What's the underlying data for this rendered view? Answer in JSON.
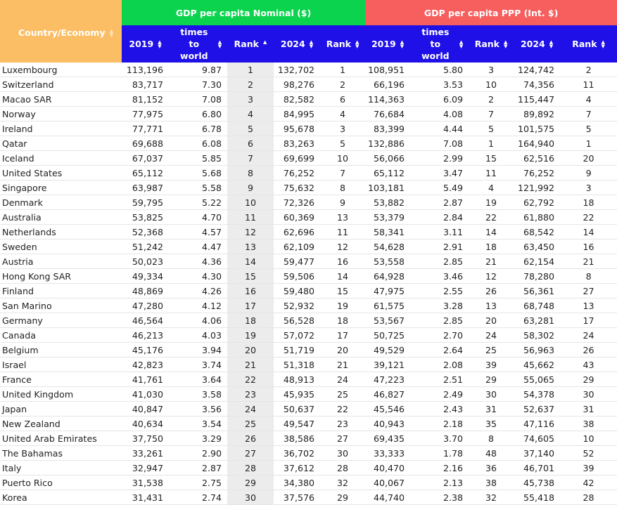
{
  "header": {
    "country": "Country/Economy",
    "nominal_group": "GDP per capita Nominal ($)",
    "ppp_group": "GDP per capita PPP (Int. $)",
    "columns": [
      "2019",
      "times to world",
      "Rank",
      "2024",
      "Rank",
      "2019",
      "times to world",
      "Rank",
      "2024",
      "Rank"
    ],
    "sorted_column": "Rank",
    "sort_direction": "ascending"
  },
  "colors": {
    "country_header": "#fbbe65",
    "nominal_header": "#0bd34d",
    "ppp_header": "#f75f5f",
    "sub_header": "#1e10e6"
  },
  "rows": [
    {
      "country": "Luxembourg",
      "n2019": "113,196",
      "ntimes": "9.87",
      "nrank": "1",
      "n2024": "132,702",
      "nrank24": "1",
      "p2019": "108,951",
      "ptimes": "5.80",
      "prank": "3",
      "p2024": "124,742",
      "prank24": "2"
    },
    {
      "country": "Switzerland",
      "n2019": "83,717",
      "ntimes": "7.30",
      "nrank": "2",
      "n2024": "98,276",
      "nrank24": "2",
      "p2019": "66,196",
      "ptimes": "3.53",
      "prank": "10",
      "p2024": "74,356",
      "prank24": "11"
    },
    {
      "country": "Macao SAR",
      "n2019": "81,152",
      "ntimes": "7.08",
      "nrank": "3",
      "n2024": "82,582",
      "nrank24": "6",
      "p2019": "114,363",
      "ptimes": "6.09",
      "prank": "2",
      "p2024": "115,447",
      "prank24": "4"
    },
    {
      "country": "Norway",
      "n2019": "77,975",
      "ntimes": "6.80",
      "nrank": "4",
      "n2024": "84,995",
      "nrank24": "4",
      "p2019": "76,684",
      "ptimes": "4.08",
      "prank": "7",
      "p2024": "89,892",
      "prank24": "7"
    },
    {
      "country": "Ireland",
      "n2019": "77,771",
      "ntimes": "6.78",
      "nrank": "5",
      "n2024": "95,678",
      "nrank24": "3",
      "p2019": "83,399",
      "ptimes": "4.44",
      "prank": "5",
      "p2024": "101,575",
      "prank24": "5"
    },
    {
      "country": "Qatar",
      "n2019": "69,688",
      "ntimes": "6.08",
      "nrank": "6",
      "n2024": "83,263",
      "nrank24": "5",
      "p2019": "132,886",
      "ptimes": "7.08",
      "prank": "1",
      "p2024": "164,940",
      "prank24": "1"
    },
    {
      "country": "Iceland",
      "n2019": "67,037",
      "ntimes": "5.85",
      "nrank": "7",
      "n2024": "69,699",
      "nrank24": "10",
      "p2019": "56,066",
      "ptimes": "2.99",
      "prank": "15",
      "p2024": "62,516",
      "prank24": "20"
    },
    {
      "country": "United States",
      "n2019": "65,112",
      "ntimes": "5.68",
      "nrank": "8",
      "n2024": "76,252",
      "nrank24": "7",
      "p2019": "65,112",
      "ptimes": "3.47",
      "prank": "11",
      "p2024": "76,252",
      "prank24": "9"
    },
    {
      "country": "Singapore",
      "n2019": "63,987",
      "ntimes": "5.58",
      "nrank": "9",
      "n2024": "75,632",
      "nrank24": "8",
      "p2019": "103,181",
      "ptimes": "5.49",
      "prank": "4",
      "p2024": "121,992",
      "prank24": "3"
    },
    {
      "country": "Denmark",
      "n2019": "59,795",
      "ntimes": "5.22",
      "nrank": "10",
      "n2024": "72,326",
      "nrank24": "9",
      "p2019": "53,882",
      "ptimes": "2.87",
      "prank": "19",
      "p2024": "62,792",
      "prank24": "18"
    },
    {
      "country": "Australia",
      "n2019": "53,825",
      "ntimes": "4.70",
      "nrank": "11",
      "n2024": "60,369",
      "nrank24": "13",
      "p2019": "53,379",
      "ptimes": "2.84",
      "prank": "22",
      "p2024": "61,880",
      "prank24": "22"
    },
    {
      "country": "Netherlands",
      "n2019": "52,368",
      "ntimes": "4.57",
      "nrank": "12",
      "n2024": "62,696",
      "nrank24": "11",
      "p2019": "58,341",
      "ptimes": "3.11",
      "prank": "14",
      "p2024": "68,542",
      "prank24": "14"
    },
    {
      "country": "Sweden",
      "n2019": "51,242",
      "ntimes": "4.47",
      "nrank": "13",
      "n2024": "62,109",
      "nrank24": "12",
      "p2019": "54,628",
      "ptimes": "2.91",
      "prank": "18",
      "p2024": "63,450",
      "prank24": "16"
    },
    {
      "country": "Austria",
      "n2019": "50,023",
      "ntimes": "4.36",
      "nrank": "14",
      "n2024": "59,477",
      "nrank24": "16",
      "p2019": "53,558",
      "ptimes": "2.85",
      "prank": "21",
      "p2024": "62,154",
      "prank24": "21"
    },
    {
      "country": "Hong Kong SAR",
      "n2019": "49,334",
      "ntimes": "4.30",
      "nrank": "15",
      "n2024": "59,506",
      "nrank24": "14",
      "p2019": "64,928",
      "ptimes": "3.46",
      "prank": "12",
      "p2024": "78,280",
      "prank24": "8"
    },
    {
      "country": "Finland",
      "n2019": "48,869",
      "ntimes": "4.26",
      "nrank": "16",
      "n2024": "59,480",
      "nrank24": "15",
      "p2019": "47,975",
      "ptimes": "2.55",
      "prank": "26",
      "p2024": "56,361",
      "prank24": "27"
    },
    {
      "country": "San Marino",
      "n2019": "47,280",
      "ntimes": "4.12",
      "nrank": "17",
      "n2024": "52,932",
      "nrank24": "19",
      "p2019": "61,575",
      "ptimes": "3.28",
      "prank": "13",
      "p2024": "68,748",
      "prank24": "13"
    },
    {
      "country": "Germany",
      "n2019": "46,564",
      "ntimes": "4.06",
      "nrank": "18",
      "n2024": "56,528",
      "nrank24": "18",
      "p2019": "53,567",
      "ptimes": "2.85",
      "prank": "20",
      "p2024": "63,281",
      "prank24": "17"
    },
    {
      "country": "Canada",
      "n2019": "46,213",
      "ntimes": "4.03",
      "nrank": "19",
      "n2024": "57,072",
      "nrank24": "17",
      "p2019": "50,725",
      "ptimes": "2.70",
      "prank": "24",
      "p2024": "58,302",
      "prank24": "24"
    },
    {
      "country": "Belgium",
      "n2019": "45,176",
      "ntimes": "3.94",
      "nrank": "20",
      "n2024": "51,719",
      "nrank24": "20",
      "p2019": "49,529",
      "ptimes": "2.64",
      "prank": "25",
      "p2024": "56,963",
      "prank24": "26"
    },
    {
      "country": "Israel",
      "n2019": "42,823",
      "ntimes": "3.74",
      "nrank": "21",
      "n2024": "51,318",
      "nrank24": "21",
      "p2019": "39,121",
      "ptimes": "2.08",
      "prank": "39",
      "p2024": "45,662",
      "prank24": "43"
    },
    {
      "country": "France",
      "n2019": "41,761",
      "ntimes": "3.64",
      "nrank": "22",
      "n2024": "48,913",
      "nrank24": "24",
      "p2019": "47,223",
      "ptimes": "2.51",
      "prank": "29",
      "p2024": "55,065",
      "prank24": "29"
    },
    {
      "country": "United Kingdom",
      "n2019": "41,030",
      "ntimes": "3.58",
      "nrank": "23",
      "n2024": "45,935",
      "nrank24": "25",
      "p2019": "46,827",
      "ptimes": "2.49",
      "prank": "30",
      "p2024": "54,378",
      "prank24": "30"
    },
    {
      "country": "Japan",
      "n2019": "40,847",
      "ntimes": "3.56",
      "nrank": "24",
      "n2024": "50,637",
      "nrank24": "22",
      "p2019": "45,546",
      "ptimes": "2.43",
      "prank": "31",
      "p2024": "52,637",
      "prank24": "31"
    },
    {
      "country": "New Zealand",
      "n2019": "40,634",
      "ntimes": "3.54",
      "nrank": "25",
      "n2024": "49,547",
      "nrank24": "23",
      "p2019": "40,943",
      "ptimes": "2.18",
      "prank": "35",
      "p2024": "47,116",
      "prank24": "38"
    },
    {
      "country": "United Arab Emirates",
      "n2019": "37,750",
      "ntimes": "3.29",
      "nrank": "26",
      "n2024": "38,586",
      "nrank24": "27",
      "p2019": "69,435",
      "ptimes": "3.70",
      "prank": "8",
      "p2024": "74,605",
      "prank24": "10"
    },
    {
      "country": "The Bahamas",
      "n2019": "33,261",
      "ntimes": "2.90",
      "nrank": "27",
      "n2024": "36,702",
      "nrank24": "30",
      "p2019": "33,333",
      "ptimes": "1.78",
      "prank": "48",
      "p2024": "37,140",
      "prank24": "52"
    },
    {
      "country": "Italy",
      "n2019": "32,947",
      "ntimes": "2.87",
      "nrank": "28",
      "n2024": "37,612",
      "nrank24": "28",
      "p2019": "40,470",
      "ptimes": "2.16",
      "prank": "36",
      "p2024": "46,701",
      "prank24": "39"
    },
    {
      "country": "Puerto Rico",
      "n2019": "31,538",
      "ntimes": "2.75",
      "nrank": "29",
      "n2024": "34,380",
      "nrank24": "32",
      "p2019": "40,067",
      "ptimes": "2.13",
      "prank": "38",
      "p2024": "45,738",
      "prank24": "42"
    },
    {
      "country": "Korea",
      "n2019": "31,431",
      "ntimes": "2.74",
      "nrank": "30",
      "n2024": "37,576",
      "nrank24": "29",
      "p2019": "44,740",
      "ptimes": "2.38",
      "prank": "32",
      "p2024": "55,418",
      "prank24": "28"
    }
  ]
}
